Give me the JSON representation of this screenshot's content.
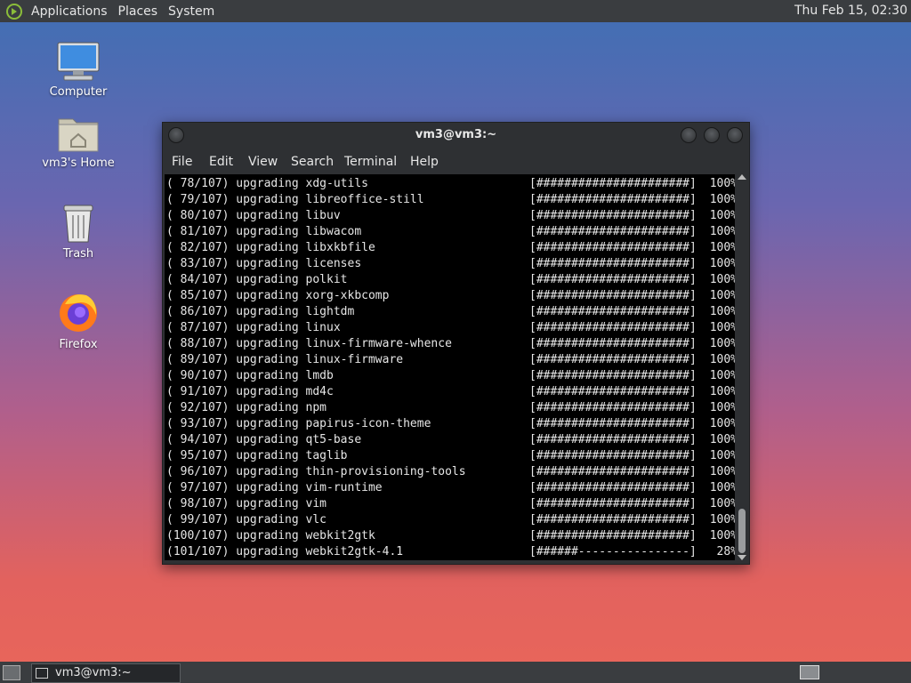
{
  "top_panel": {
    "menus": [
      "Applications",
      "Places",
      "System"
    ],
    "clock": "Thu Feb 15, 02:30"
  },
  "desktop_icons": [
    {
      "label": "Computer",
      "icon": "computer-icon"
    },
    {
      "label": "vm3's Home",
      "icon": "home-folder-icon"
    },
    {
      "label": "Trash",
      "icon": "trash-icon"
    },
    {
      "label": "Firefox",
      "icon": "firefox-icon"
    }
  ],
  "terminal": {
    "title": "vm3@vm3:~",
    "menu": [
      "File",
      "Edit",
      "View",
      "Search",
      "Terminal",
      "Help"
    ],
    "lines": [
      {
        "left": "( 78/107) upgrading xdg-utils",
        "bar": "[######################]",
        "pct": "100%"
      },
      {
        "left": "( 79/107) upgrading libreoffice-still",
        "bar": "[######################]",
        "pct": "100%"
      },
      {
        "left": "( 80/107) upgrading libuv",
        "bar": "[######################]",
        "pct": "100%"
      },
      {
        "left": "( 81/107) upgrading libwacom",
        "bar": "[######################]",
        "pct": "100%"
      },
      {
        "left": "( 82/107) upgrading libxkbfile",
        "bar": "[######################]",
        "pct": "100%"
      },
      {
        "left": "( 83/107) upgrading licenses",
        "bar": "[######################]",
        "pct": "100%"
      },
      {
        "left": "( 84/107) upgrading polkit",
        "bar": "[######################]",
        "pct": "100%"
      },
      {
        "left": "( 85/107) upgrading xorg-xkbcomp",
        "bar": "[######################]",
        "pct": "100%"
      },
      {
        "left": "( 86/107) upgrading lightdm",
        "bar": "[######################]",
        "pct": "100%"
      },
      {
        "left": "( 87/107) upgrading linux",
        "bar": "[######################]",
        "pct": "100%"
      },
      {
        "left": "( 88/107) upgrading linux-firmware-whence",
        "bar": "[######################]",
        "pct": "100%"
      },
      {
        "left": "( 89/107) upgrading linux-firmware",
        "bar": "[######################]",
        "pct": "100%"
      },
      {
        "left": "( 90/107) upgrading lmdb",
        "bar": "[######################]",
        "pct": "100%"
      },
      {
        "left": "( 91/107) upgrading md4c",
        "bar": "[######################]",
        "pct": "100%"
      },
      {
        "left": "( 92/107) upgrading npm",
        "bar": "[######################]",
        "pct": "100%"
      },
      {
        "left": "( 93/107) upgrading papirus-icon-theme",
        "bar": "[######################]",
        "pct": "100%"
      },
      {
        "left": "( 94/107) upgrading qt5-base",
        "bar": "[######################]",
        "pct": "100%"
      },
      {
        "left": "( 95/107) upgrading taglib",
        "bar": "[######################]",
        "pct": "100%"
      },
      {
        "left": "( 96/107) upgrading thin-provisioning-tools",
        "bar": "[######################]",
        "pct": "100%"
      },
      {
        "left": "( 97/107) upgrading vim-runtime",
        "bar": "[######################]",
        "pct": "100%"
      },
      {
        "left": "( 98/107) upgrading vim",
        "bar": "[######################]",
        "pct": "100%"
      },
      {
        "left": "( 99/107) upgrading vlc",
        "bar": "[######################]",
        "pct": "100%"
      },
      {
        "left": "(100/107) upgrading webkit2gtk",
        "bar": "[######################]",
        "pct": "100%"
      },
      {
        "left": "(101/107) upgrading webkit2gtk-4.1",
        "bar": "[######----------------]",
        "pct": "28%"
      }
    ]
  },
  "taskbar": {
    "task_label": "vm3@vm3:~"
  }
}
